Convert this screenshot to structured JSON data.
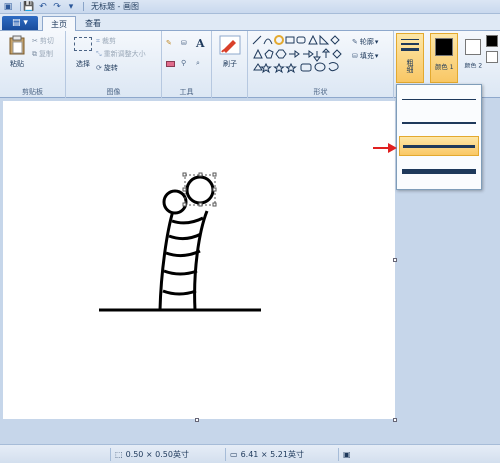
{
  "title": {
    "doc": "无标题 - 画图"
  },
  "tabs": {
    "file": "▤ ▾",
    "home": "主页",
    "view": "查看"
  },
  "groups": {
    "clipboard": {
      "label": "剪贴板",
      "paste": "粘贴",
      "cut": "剪切",
      "copy": "复制"
    },
    "image": {
      "label": "图像",
      "select": "选择",
      "crop": "裁剪",
      "resize": "重新调整大小",
      "rotate": "旋转"
    },
    "tools": {
      "label": "工具"
    },
    "brushes": {
      "label": "刷子"
    },
    "shapes": {
      "label": "形状",
      "outline": "轮廓",
      "fill": "填充"
    },
    "size": {
      "label": "粗细"
    },
    "color1": {
      "label": "颜色 1"
    },
    "color2": {
      "label": "颜色 2"
    }
  },
  "dropdown": {
    "items": [
      {
        "name": "thin-1px",
        "width": 1
      },
      {
        "name": "medium-3px",
        "width": 2
      },
      {
        "name": "thick-5px",
        "width": 3,
        "selected": true
      },
      {
        "name": "thicker-8px",
        "width": 5
      }
    ]
  },
  "status": {
    "selection": "0.50 × 0.50英寸",
    "canvas": "6.41 × 5.21英寸"
  },
  "colors": {
    "accent": "#2d6bc3",
    "selected": "#f9c765"
  }
}
